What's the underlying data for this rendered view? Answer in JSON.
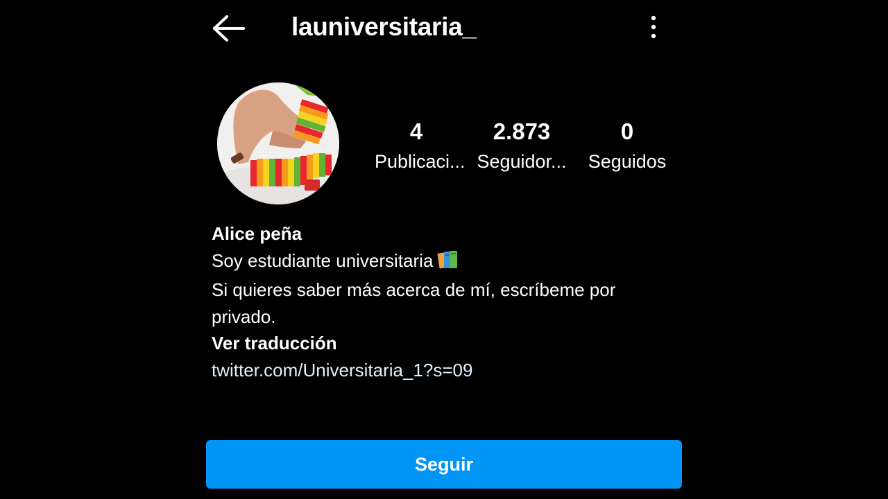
{
  "header": {
    "username": "launiversitaria_",
    "back_icon": "arrow-left-icon",
    "more_icon": "more-vertical-icon"
  },
  "profile": {
    "avatar": "profile-photo",
    "stats": [
      {
        "value": "4",
        "label": "Publicaci..."
      },
      {
        "value": "2.873",
        "label": "Seguidor..."
      },
      {
        "value": "0",
        "label": "Seguidos"
      }
    ]
  },
  "bio": {
    "name": "Alice peña",
    "line1": "Soy estudiante universitaria",
    "line1_emoji": "books-icon",
    "line2": "Si quieres saber más acerca de mí, escríbeme por privado.",
    "translate": "Ver traducción",
    "link": "twitter.com/Universitaria_1?s=09"
  },
  "actions": {
    "follow_label": "Seguir"
  },
  "colors": {
    "background": "#000000",
    "text": "#ffffff",
    "accent": "#0095f6"
  }
}
